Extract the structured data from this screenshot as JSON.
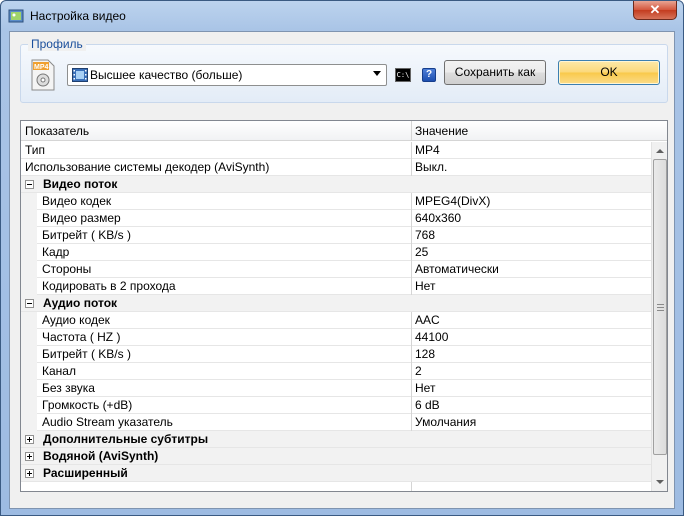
{
  "window": {
    "title": "Настройка видео",
    "close_label": "✕"
  },
  "profile": {
    "legend": "Профиль",
    "icon_label": "MP4",
    "selected": "Высшее качество (больше)",
    "cmd_label": "C:\\",
    "help_label": "?",
    "save_as_label": "Сохранить как",
    "ok_label": "OK"
  },
  "grid": {
    "col_name": "Показатель",
    "col_value": "Значение",
    "rows": [
      {
        "type": "prop",
        "label": "Тип",
        "value": "MP4"
      },
      {
        "type": "prop",
        "label": "Использование системы декодер (AviSynth)",
        "value": "Выкл."
      },
      {
        "type": "cat",
        "label": "Видео поток",
        "expanded": true
      },
      {
        "type": "child",
        "label": "Видео кодек",
        "value": "MPEG4(DivX)"
      },
      {
        "type": "child",
        "label": "Видео размер",
        "value": "640x360"
      },
      {
        "type": "child",
        "label": "Битрейт ( KB/s )",
        "value": "768"
      },
      {
        "type": "child",
        "label": "Кадр",
        "value": "25"
      },
      {
        "type": "child",
        "label": "Стороны",
        "value": "Автоматически"
      },
      {
        "type": "child",
        "label": "Кодировать в 2 прохода",
        "value": "Нет"
      },
      {
        "type": "cat",
        "label": "Аудио поток",
        "expanded": true
      },
      {
        "type": "child",
        "label": "Аудио кодек",
        "value": "AAC"
      },
      {
        "type": "child",
        "label": "Частота ( HZ )",
        "value": "44100"
      },
      {
        "type": "child",
        "label": "Битрейт ( KB/s )",
        "value": "128"
      },
      {
        "type": "child",
        "label": "Канал",
        "value": "2"
      },
      {
        "type": "child",
        "label": "Без звука",
        "value": "Нет"
      },
      {
        "type": "child",
        "label": "Громкость (+dB)",
        "value": "6 dB"
      },
      {
        "type": "child",
        "label": "Audio Stream указатель",
        "value": "Умолчания"
      },
      {
        "type": "cat",
        "label": "Дополнительные субтитры",
        "expanded": false
      },
      {
        "type": "cat",
        "label": "Водяной (AviSynth)",
        "expanded": false
      },
      {
        "type": "cat",
        "label": "Расширенный",
        "expanded": false
      }
    ]
  }
}
